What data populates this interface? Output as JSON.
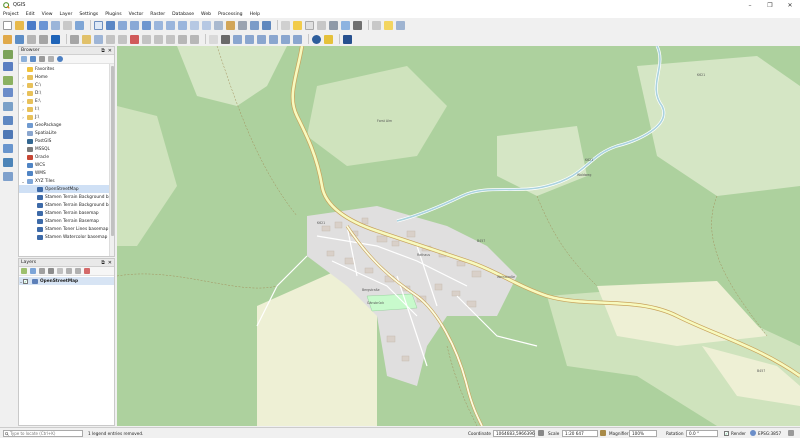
{
  "window": {
    "title": "QGIS",
    "minimize": "–",
    "maximize": "❐",
    "close": "✕"
  },
  "menu": [
    "Project",
    "Edit",
    "View",
    "Layer",
    "Settings",
    "Plugins",
    "Vector",
    "Raster",
    "Database",
    "Web",
    "Processing",
    "Help"
  ],
  "browser": {
    "title": "Browser",
    "float_btn": "⧉",
    "close_btn": "✕",
    "items": [
      {
        "label": "Favorites",
        "icon": "star-icon",
        "arrow": ""
      },
      {
        "label": "Home",
        "icon": "folder-icon",
        "arrow": "›"
      },
      {
        "label": "C:\\",
        "icon": "folder-icon",
        "arrow": "›"
      },
      {
        "label": "D:\\",
        "icon": "folder-icon",
        "arrow": "›"
      },
      {
        "label": "E:\\",
        "icon": "folder-icon",
        "arrow": "›"
      },
      {
        "label": "I:\\",
        "icon": "folder-icon",
        "arrow": "›"
      },
      {
        "label": "J:\\",
        "icon": "folder-icon",
        "arrow": "›"
      },
      {
        "label": "GeoPackage",
        "icon": "geopackage-icon",
        "arrow": ""
      },
      {
        "label": "SpatiaLite",
        "icon": "spatialite-icon",
        "arrow": ""
      },
      {
        "label": "PostGIS",
        "icon": "postgis-icon",
        "arrow": ""
      },
      {
        "label": "MSSQL",
        "icon": "mssql-icon",
        "arrow": ""
      },
      {
        "label": "Oracle",
        "icon": "oracle-icon",
        "arrow": ""
      },
      {
        "label": "WCS",
        "icon": "wcs-icon",
        "arrow": ""
      },
      {
        "label": "WMS",
        "icon": "wms-icon",
        "arrow": ""
      },
      {
        "label": "XYZ Tiles",
        "icon": "xyz-tiles-icon",
        "arrow": "⌄"
      },
      {
        "label": "OpenStreetMap",
        "icon": "tile-icon",
        "arrow": "",
        "selected": true
      },
      {
        "label": "Stamen Terrain Background ba",
        "icon": "tile-icon",
        "arrow": ""
      },
      {
        "label": "Stamen Terrain Background ba",
        "icon": "tile-icon",
        "arrow": ""
      },
      {
        "label": "Stamen Terrain basemap",
        "icon": "tile-icon",
        "arrow": ""
      },
      {
        "label": "Stamen Terrain Basemap",
        "icon": "tile-icon",
        "arrow": ""
      },
      {
        "label": "Stamen Toner Lines basemap",
        "icon": "tile-icon",
        "arrow": ""
      },
      {
        "label": "Stamen Watercolor basemap",
        "icon": "tile-icon",
        "arrow": ""
      }
    ]
  },
  "layers": {
    "title": "Layers",
    "float_btn": "⧉",
    "close_btn": "✕",
    "items": [
      {
        "label": "OpenStreetMap",
        "checked": "✓",
        "arrow": "⌄"
      }
    ]
  },
  "map": {
    "labels": [
      "Forst Alm",
      "K621",
      "K621",
      "K621",
      "B457",
      "B457",
      "Weinstraße",
      "Rathaus",
      "Bergstraße",
      "Gänsbrück",
      "Waldweg"
    ]
  },
  "status": {
    "locator_placeholder": "Type to locate (Ctrl+K)",
    "message": "1 legend entries removed.",
    "coordinate_label": "Coordinate",
    "coordinate_value": "1064683,5966396",
    "scale_label": "Scale",
    "scale_value": "1:20 647",
    "magnifier_label": "Magnifier",
    "magnifier_value": "100%",
    "rotation_label": "Rotation",
    "rotation_value": "0.0 °",
    "render_label": "Render",
    "render_checked": "✓",
    "crs": "EPSG:3857"
  },
  "colors": {
    "forest": "#add19e",
    "open": "#d5e6c5",
    "road": "#f7fabf",
    "road_edge": "#c8a25a",
    "river": "#aad3df",
    "urban": "#e0dfdf",
    "building": "#d9d0c9",
    "park": "#c8facc",
    "farmland": "#eef0d5"
  }
}
